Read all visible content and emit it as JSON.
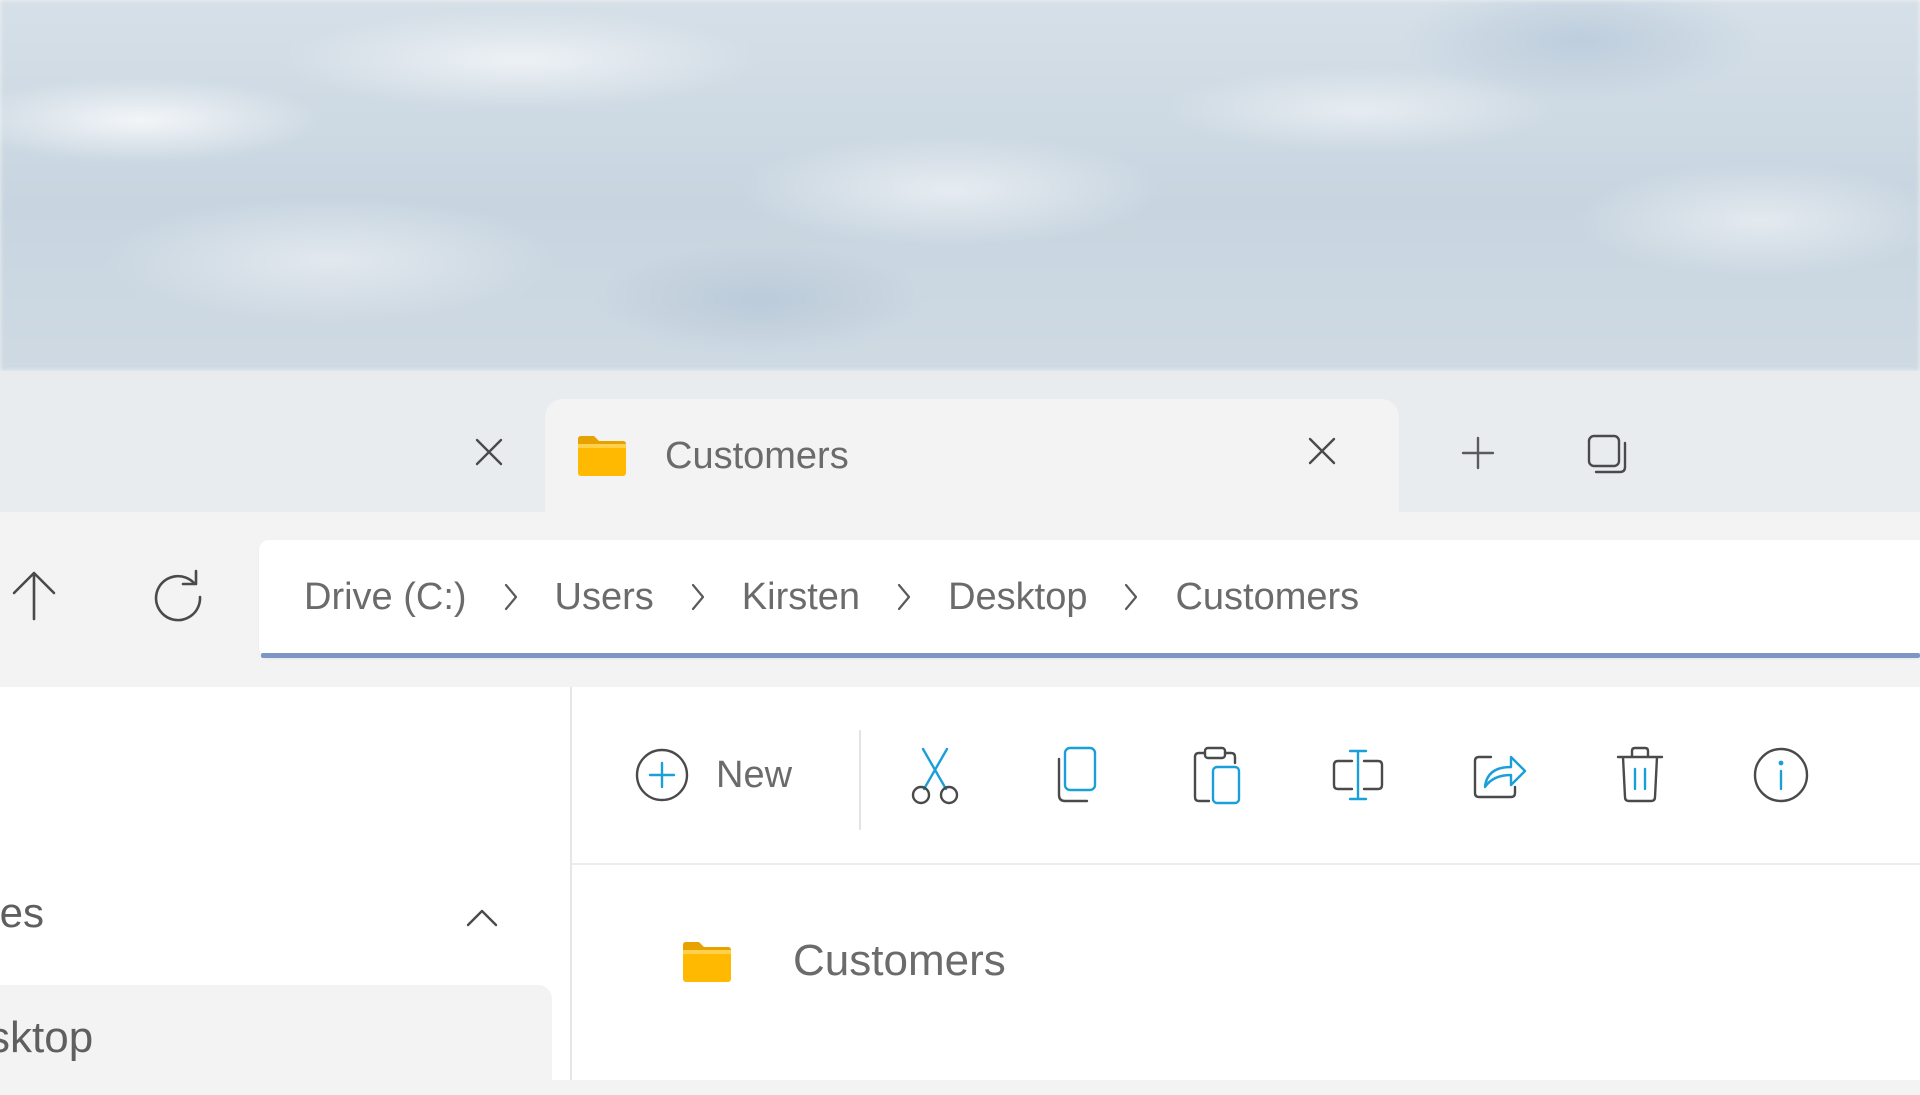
{
  "window": {
    "active_tab": {
      "title": "Customers",
      "icon": "folder-icon"
    },
    "previous_tab": {
      "title": ""
    }
  },
  "navigation": {
    "breadcrumbs": [
      "Drive (C:)",
      "Users",
      "Kirsten",
      "Desktop",
      "Customers"
    ]
  },
  "sidebar": {
    "section_label": "tes",
    "selected_item_label": "sktop"
  },
  "toolbar": {
    "new_label": "New",
    "icons": [
      "cut-icon",
      "copy-icon",
      "paste-icon",
      "rename-icon",
      "share-icon",
      "delete-icon",
      "info-icon"
    ]
  },
  "files": [
    {
      "name": "Customers",
      "type": "folder"
    }
  ],
  "colors": {
    "accent": "#1a9fd9",
    "folder": "#ffb900",
    "address_underline": "#7e96c6",
    "text": "#6b6b6b"
  }
}
